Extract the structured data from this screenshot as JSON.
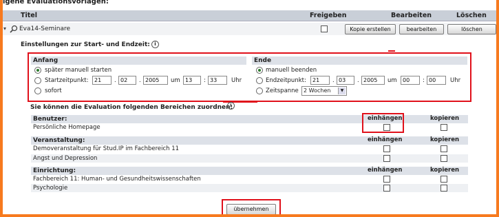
{
  "header": {
    "title": "igene Evaluationsvorlagen:"
  },
  "table": {
    "col_title": "Titel",
    "col_release": "Freigeben",
    "col_edit": "Bearbeiten",
    "col_delete": "Löschen"
  },
  "item": {
    "name": "Eva14-Seminare",
    "copy_btn": "Kopie erstellen",
    "edit_btn": "bearbeiten",
    "delete_btn": "löschen"
  },
  "settings": {
    "heading": "Einstellungen zur Start- und Endzeit:"
  },
  "start": {
    "heading": "Anfang",
    "opt_manual": "später manuell starten",
    "opt_time": "Startzeitpunkt:",
    "day": "21",
    "month": "02",
    "year": "2005",
    "um": "um",
    "hour": "13",
    "minute": "33",
    "uhr": "Uhr",
    "opt_now": "sofort"
  },
  "end": {
    "heading": "Ende",
    "opt_manual": "manuell beenden",
    "opt_time": "Endzeitpunkt:",
    "day": "21",
    "month": "03",
    "year": "2005",
    "um": "um",
    "hour": "00",
    "minute": "00",
    "uhr": "Uhr",
    "opt_span": "Zeitspanne",
    "span_value": "2 Wochen"
  },
  "assign": {
    "heading": "Sie können die Evaluation folgenden Bereichen zuordnen:",
    "col_attach": "einhängen",
    "col_copy": "kopieren",
    "groups": [
      {
        "title": "Benutzer:",
        "rows": [
          "Persönliche Homepage"
        ]
      },
      {
        "title": "Veranstaltung:",
        "rows": [
          "Demoveranstaltung für Stud.IP im Fachbereich 11",
          "Angst und Depression"
        ]
      },
      {
        "title": "Einrichtung:",
        "rows": [
          "Fachbereich 11: Human- und Gesundheitswissenschaften",
          "Psychologie"
        ]
      }
    ]
  },
  "submit": {
    "label": "übernehmen"
  },
  "colors": {
    "frame": "#f77a1e",
    "header_bg": "#c9cfd8",
    "highlight": "#e0101a"
  }
}
